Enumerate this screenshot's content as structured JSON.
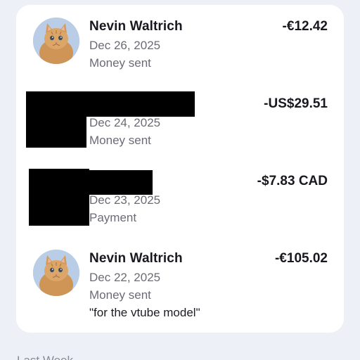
{
  "transactions": [
    {
      "name": "Nevin Waltrich",
      "date": "Dec 26, 2025",
      "type": "Money sent",
      "amount": "-€12.42",
      "avatar": "cat-photo-avatar",
      "note": ""
    },
    {
      "name": "",
      "date": "Dec 24, 2025",
      "type": "Money sent",
      "amount": "-US$29.51",
      "avatar": "redacted",
      "note": ""
    },
    {
      "name": "",
      "date": "Dec 23, 2025",
      "type": "Payment",
      "amount": "-$7.83 CAD",
      "avatar": "redacted",
      "note": ""
    },
    {
      "name": "Nevin Waltrich",
      "date": "Dec 22, 2025",
      "type": "Money sent",
      "amount": "-€105.02",
      "avatar": "cat-photo-avatar",
      "note": "\"for the vtube model\""
    }
  ],
  "section_peek": "Last Week",
  "colors": {
    "background": "#eef0f8",
    "card": "#ffffff",
    "text_primary": "#18181f",
    "text_secondary": "#6b6b76"
  }
}
